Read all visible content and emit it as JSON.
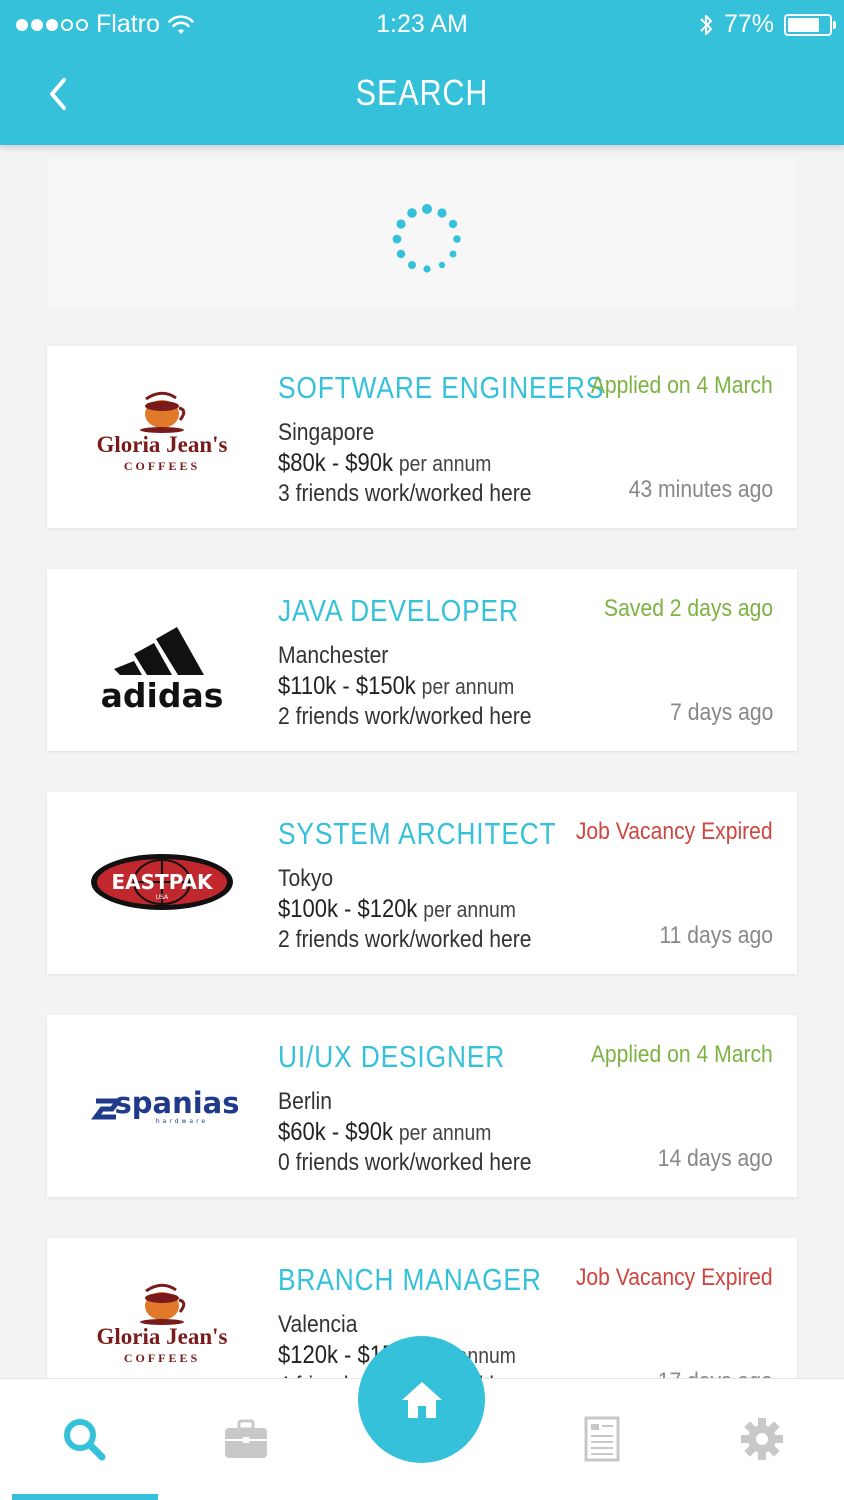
{
  "status_bar": {
    "carrier": "Flatro",
    "time": "1:23 AM",
    "battery": "77%",
    "battery_level": 0.77
  },
  "header": {
    "title": "SEARCH"
  },
  "jobs": [
    {
      "company": "Gloria Jean's Coffees",
      "logo": "gloria-jeans-logo",
      "title": "SOFTWARE ENGINEERS",
      "status": "Applied on 4 March",
      "status_color": "#7cb342",
      "location": "Singapore",
      "salary": "$80k - $90k",
      "per": "per annum",
      "friends": "3 friends work/worked here",
      "time": "43 minutes ago"
    },
    {
      "company": "adidas",
      "logo": "adidas-logo",
      "title": "JAVA DEVELOPER",
      "status": "Saved 2 days ago",
      "status_color": "#7cb342",
      "location": "Manchester",
      "salary": "$110k - $150k",
      "per": "per annum",
      "friends": "2 friends work/worked here",
      "time": "7 days ago"
    },
    {
      "company": "Eastpak",
      "logo": "eastpak-logo",
      "title": "SYSTEM ARCHITECT",
      "status": "Job Vacancy Expired",
      "status_color": "#d0453f",
      "location": "Tokyo",
      "salary": "$100k - $120k",
      "per": "per annum",
      "friends": "2 friends work/worked here",
      "time": "11 days ago"
    },
    {
      "company": "spanias",
      "logo": "spanias-logo",
      "title": "UI/UX DESIGNER",
      "status": "Applied on 4 March",
      "status_color": "#7cb342",
      "location": "Berlin",
      "salary": "$60k - $90k",
      "per": "per annum",
      "friends": "0 friends work/worked here",
      "time": "14 days ago"
    },
    {
      "company": "Gloria Jean's Coffees",
      "logo": "gloria-jeans-logo",
      "title": "BRANCH MANAGER",
      "status": "Job Vacancy Expired",
      "status_color": "#d0453f",
      "location": "Valencia",
      "salary": "$120k - $150k",
      "per": "per annum",
      "friends": "4 friends work/worked here",
      "time": "17 days ago"
    }
  ],
  "logos": {
    "gloria": {
      "line1": "Gloria Jean's",
      "line2": "COFFEES"
    },
    "adidas": {
      "text": "adidas"
    },
    "eastpak": {
      "text": "EASTPAK",
      "sub": "USA"
    },
    "spanias": {
      "text": "spanias",
      "sub": "hardware"
    }
  },
  "nav": {
    "items": [
      "search-icon",
      "briefcase-icon",
      "home-icon",
      "document-icon",
      "gear-icon"
    ],
    "active": "search",
    "accent": "#35c1da"
  }
}
